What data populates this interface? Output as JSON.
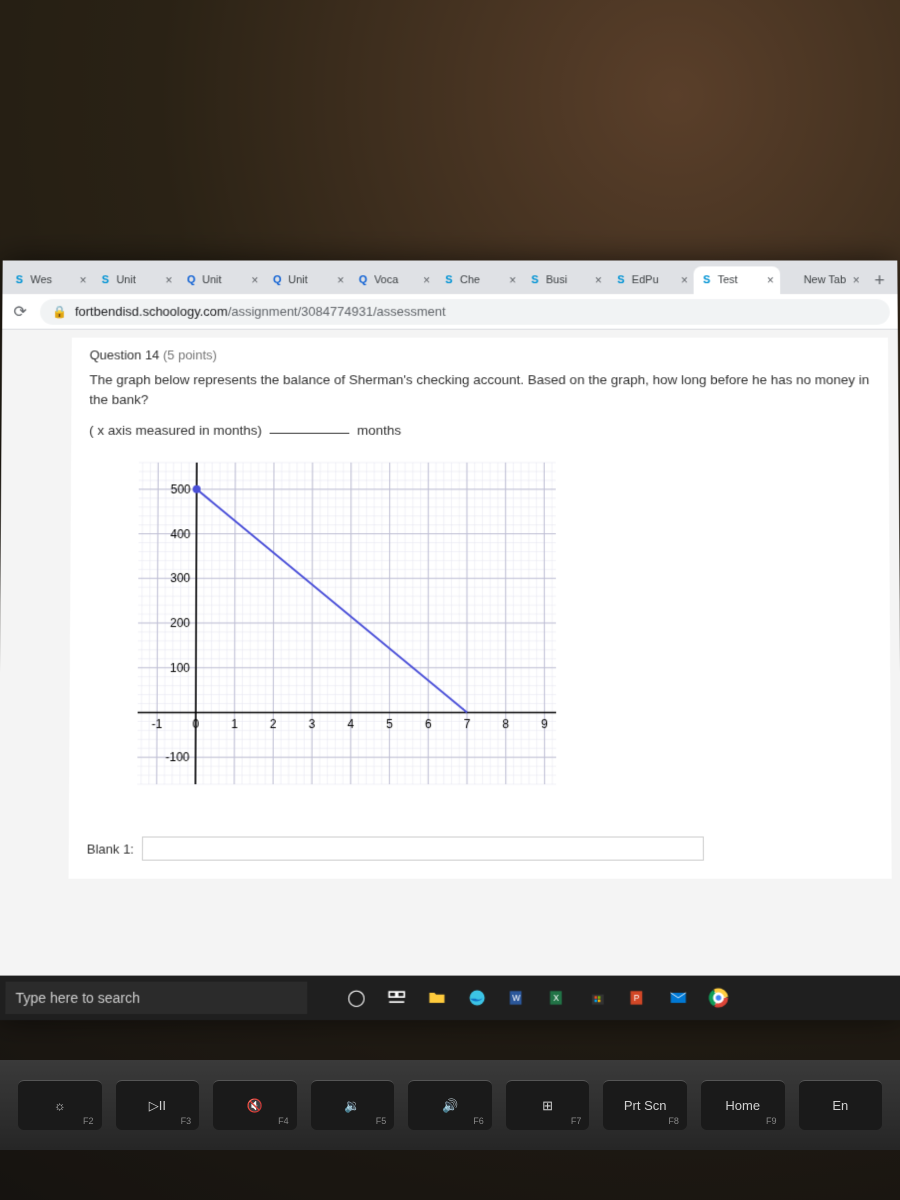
{
  "browser": {
    "tabs": [
      {
        "icon": "s",
        "label": "Wes"
      },
      {
        "icon": "s",
        "label": "Unit"
      },
      {
        "icon": "q",
        "label": "Unit"
      },
      {
        "icon": "q",
        "label": "Unit"
      },
      {
        "icon": "q",
        "label": "Voca"
      },
      {
        "icon": "s",
        "label": "Che"
      },
      {
        "icon": "s",
        "label": "Busi"
      },
      {
        "icon": "s",
        "label": "EdPu"
      },
      {
        "icon": "s",
        "label": "Test",
        "active": true
      },
      {
        "icon": "",
        "label": "New Tab"
      }
    ],
    "url_domain": "fortbendisd.schoology.com",
    "url_path": "/assignment/3084774931/assessment"
  },
  "question": {
    "number": "Question 14",
    "points": "(5 points)",
    "prompt": "The graph below represents the balance of Sherman's checking account. Based on the graph, how long before he has no money in the bank?",
    "sub_prefix": "( x axis measured in months)",
    "sub_suffix": "months",
    "blank_label": "Blank 1:"
  },
  "chart_data": {
    "type": "line",
    "title": "",
    "xlabel": "",
    "ylabel": "",
    "x_ticks": [
      -1,
      0,
      1,
      2,
      3,
      4,
      5,
      6,
      7,
      8,
      9
    ],
    "y_ticks": [
      -100,
      100,
      200,
      300,
      400,
      500
    ],
    "xlim": [
      -1.5,
      9.3
    ],
    "ylim": [
      -160,
      560
    ],
    "series": [
      {
        "name": "balance",
        "x": [
          0,
          7
        ],
        "y": [
          500,
          0
        ],
        "color": "#4a4fd8"
      }
    ],
    "point": {
      "x": 0,
      "y": 500
    }
  },
  "taskbar": {
    "search_placeholder": "Type here to search"
  },
  "keys": [
    {
      "main": "☼",
      "sub": "F2"
    },
    {
      "main": "▷II",
      "sub": "F3"
    },
    {
      "main": "🔇",
      "sub": "F4"
    },
    {
      "main": "🔉",
      "sub": "F5"
    },
    {
      "main": "🔊",
      "sub": "F6"
    },
    {
      "main": "⊞",
      "sub": "F7"
    },
    {
      "main": "Prt Scn",
      "sub": "F8"
    },
    {
      "main": "Home",
      "sub": "F9"
    },
    {
      "main": "En",
      "sub": ""
    }
  ]
}
